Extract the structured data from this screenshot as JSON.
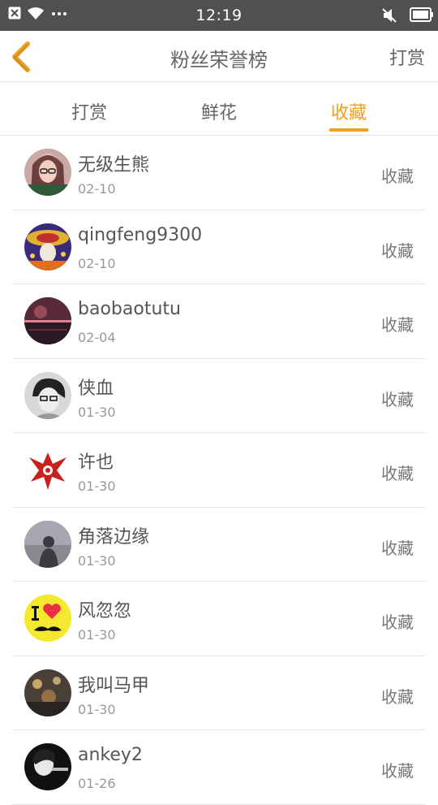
{
  "status_bar": {
    "time": "12:19"
  },
  "header": {
    "title": "粉丝荣誉榜",
    "action": "打赏"
  },
  "tabs": [
    {
      "label": "打赏",
      "active": false
    },
    {
      "label": "鲜花",
      "active": false
    },
    {
      "label": "收藏",
      "active": true
    }
  ],
  "accent_color": "#f0a020",
  "fans": [
    {
      "name": "无级生熊",
      "date": "02-10",
      "type": "收藏"
    },
    {
      "name": "qingfeng9300",
      "date": "02-10",
      "type": "收藏"
    },
    {
      "name": "baobaotutu",
      "date": "02-04",
      "type": "收藏"
    },
    {
      "name": "侠血",
      "date": "01-30",
      "type": "收藏"
    },
    {
      "name": "许也",
      "date": "01-30",
      "type": "收藏"
    },
    {
      "name": "角落边缘",
      "date": "01-30",
      "type": "收藏"
    },
    {
      "name": "风忽忽",
      "date": "01-30",
      "type": "收藏"
    },
    {
      "name": "我叫马甲",
      "date": "01-30",
      "type": "收藏"
    },
    {
      "name": "ankey2",
      "date": "01-26",
      "type": "收藏"
    }
  ]
}
